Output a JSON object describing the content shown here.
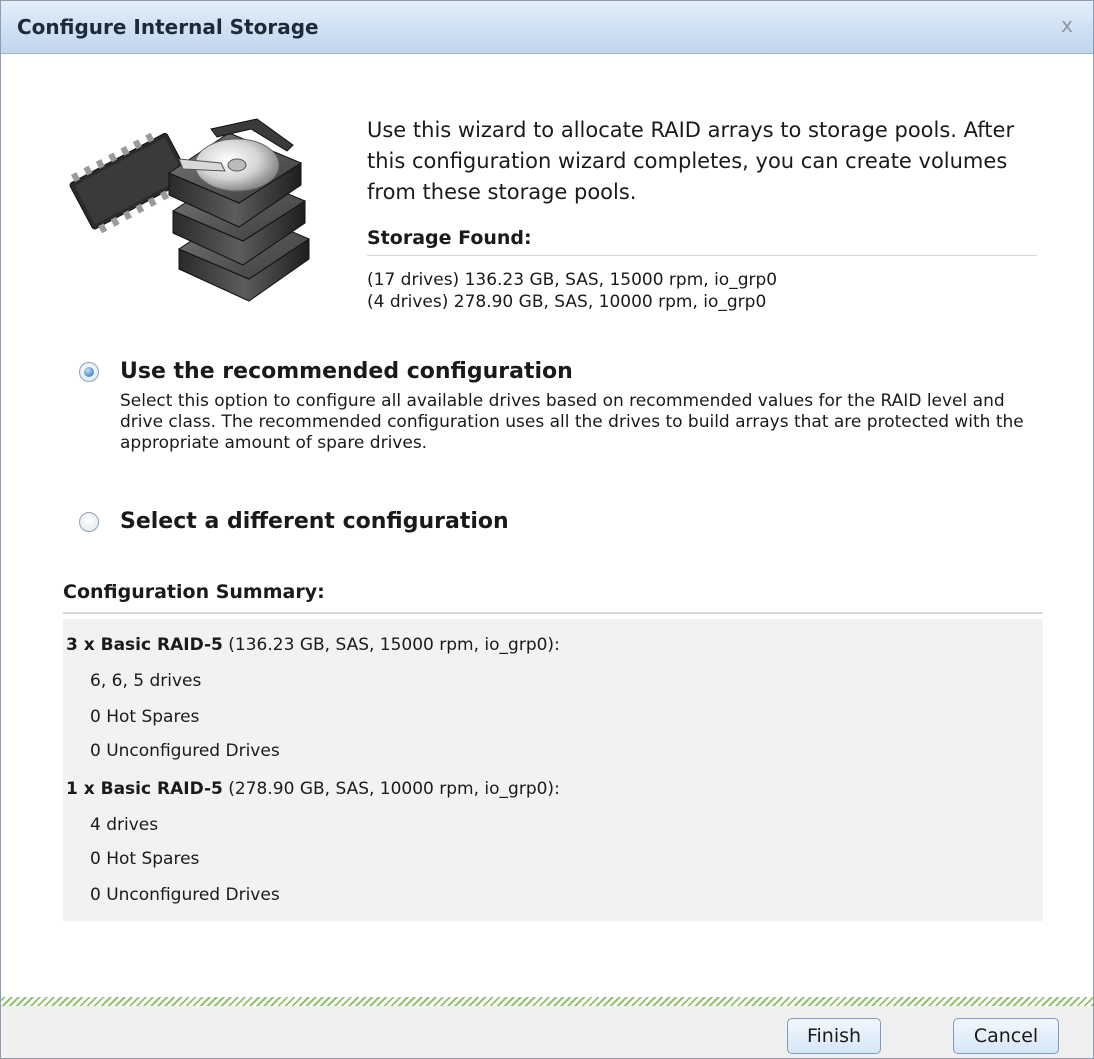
{
  "dialog": {
    "title": "Configure Internal Storage",
    "close_glyph": "x"
  },
  "intro": {
    "text": "Use this wizard to allocate RAID arrays to storage pools. After this configuration wizard completes, you can create volumes from these storage pools.",
    "image_icon": "storage-drives-icon"
  },
  "storage_found": {
    "heading": "Storage Found:",
    "items": [
      "(17 drives) 136.23 GB, SAS, 15000 rpm, io_grp0",
      "(4 drives) 278.90 GB, SAS, 10000 rpm, io_grp0"
    ]
  },
  "options": {
    "recommended": {
      "label": "Use the recommended configuration",
      "description": "Select this option to configure all available drives based on recommended values for the RAID level and drive class. The recommended configuration uses all the drives to build arrays that are protected with the appropriate amount of spare drives.",
      "selected": true
    },
    "different": {
      "label": "Select a different configuration",
      "selected": false
    }
  },
  "summary": {
    "heading": "Configuration Summary:",
    "groups": [
      {
        "title_bold": "3 x Basic RAID-5",
        "title_rest": " (136.23 GB, SAS, 15000 rpm, io_grp0):",
        "lines": [
          "6, 6, 5 drives",
          "0 Hot Spares",
          "0 Unconfigured Drives"
        ]
      },
      {
        "title_bold": "1 x Basic RAID-5",
        "title_rest": " (278.90 GB, SAS, 10000 rpm, io_grp0):",
        "lines": [
          "4 drives",
          "0 Hot Spares",
          "0 Unconfigured Drives"
        ]
      }
    ]
  },
  "buttons": {
    "finish": "Finish",
    "cancel": "Cancel"
  },
  "colors": {
    "title_bar": "#cfe0f3",
    "accent_radio": "#5d9ad7",
    "progress_hatch": "#8fc26a"
  }
}
